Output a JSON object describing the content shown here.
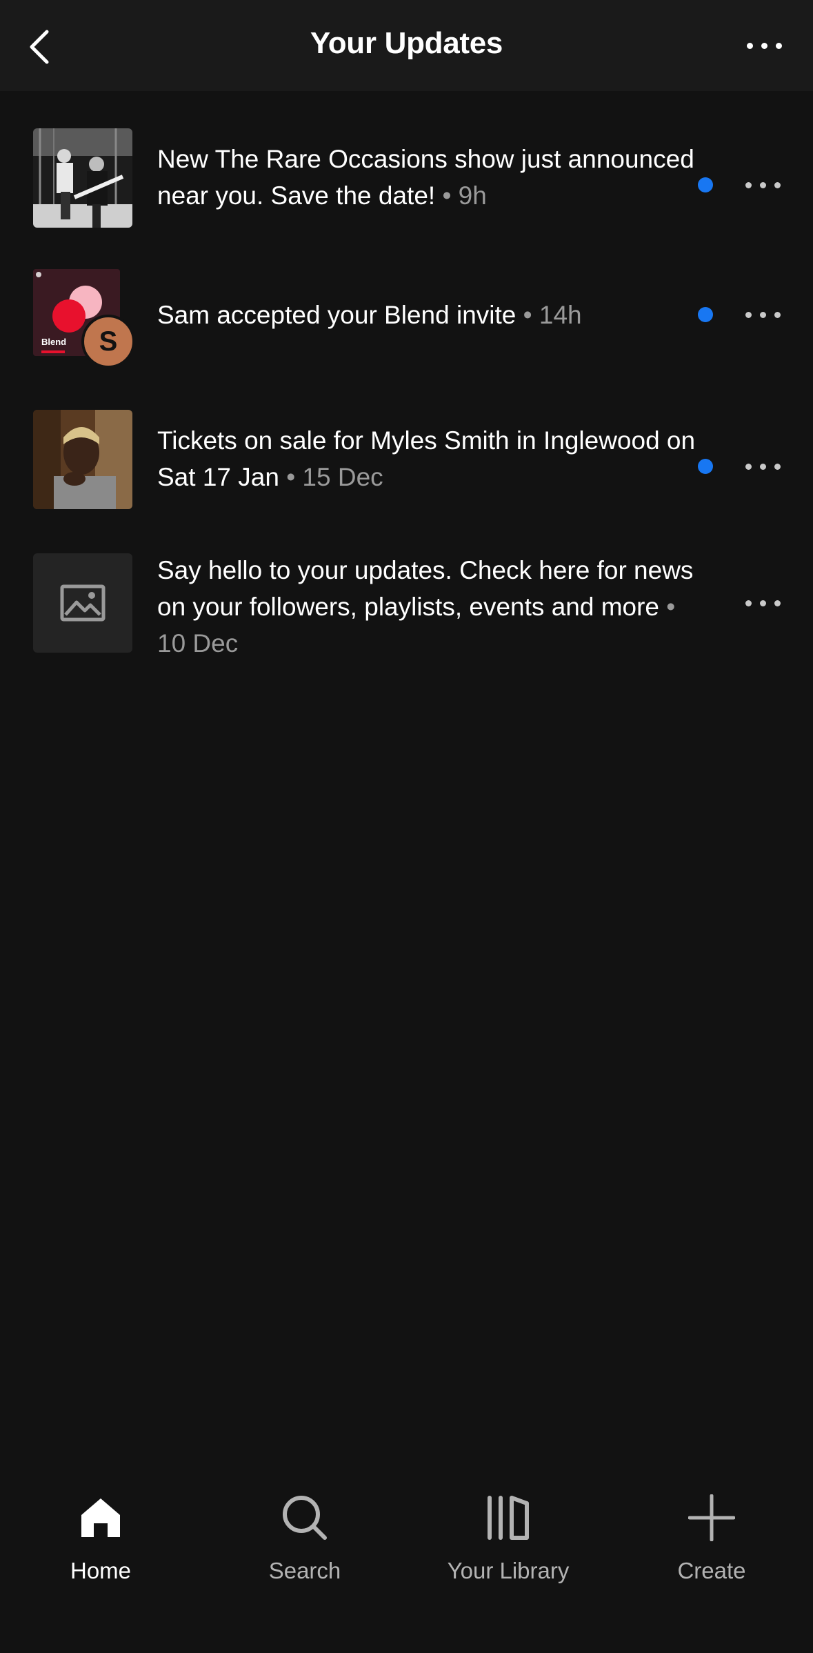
{
  "header": {
    "title": "Your Updates"
  },
  "updates": [
    {
      "text": "New The Rare Occasions show just announced near you. Save the date!",
      "time": "• 9h",
      "unread": true,
      "thumb": "band-photo"
    },
    {
      "text": "Sam accepted your Blend invite",
      "time": "• 14h",
      "unread": true,
      "thumb": "blend-cover",
      "blend_label": "Blend",
      "avatar_initial": "S"
    },
    {
      "text": "Tickets on sale for Myles Smith in Inglewood on Sat 17 Jan",
      "time": "• 15 Dec",
      "unread": true,
      "thumb": "artist-photo"
    },
    {
      "text": "Say hello to your updates. Check here for news on your followers, playlists, events and more",
      "time": "• 10 Dec",
      "unread": false,
      "thumb": "image-placeholder-icon"
    }
  ],
  "nav": {
    "home": "Home",
    "search": "Search",
    "library": "Your Library",
    "create": "Create"
  },
  "colors": {
    "background": "#121212",
    "unread_dot": "#1877f2",
    "avatar": "#c0764e",
    "blend_cover": "#3a1a22"
  }
}
